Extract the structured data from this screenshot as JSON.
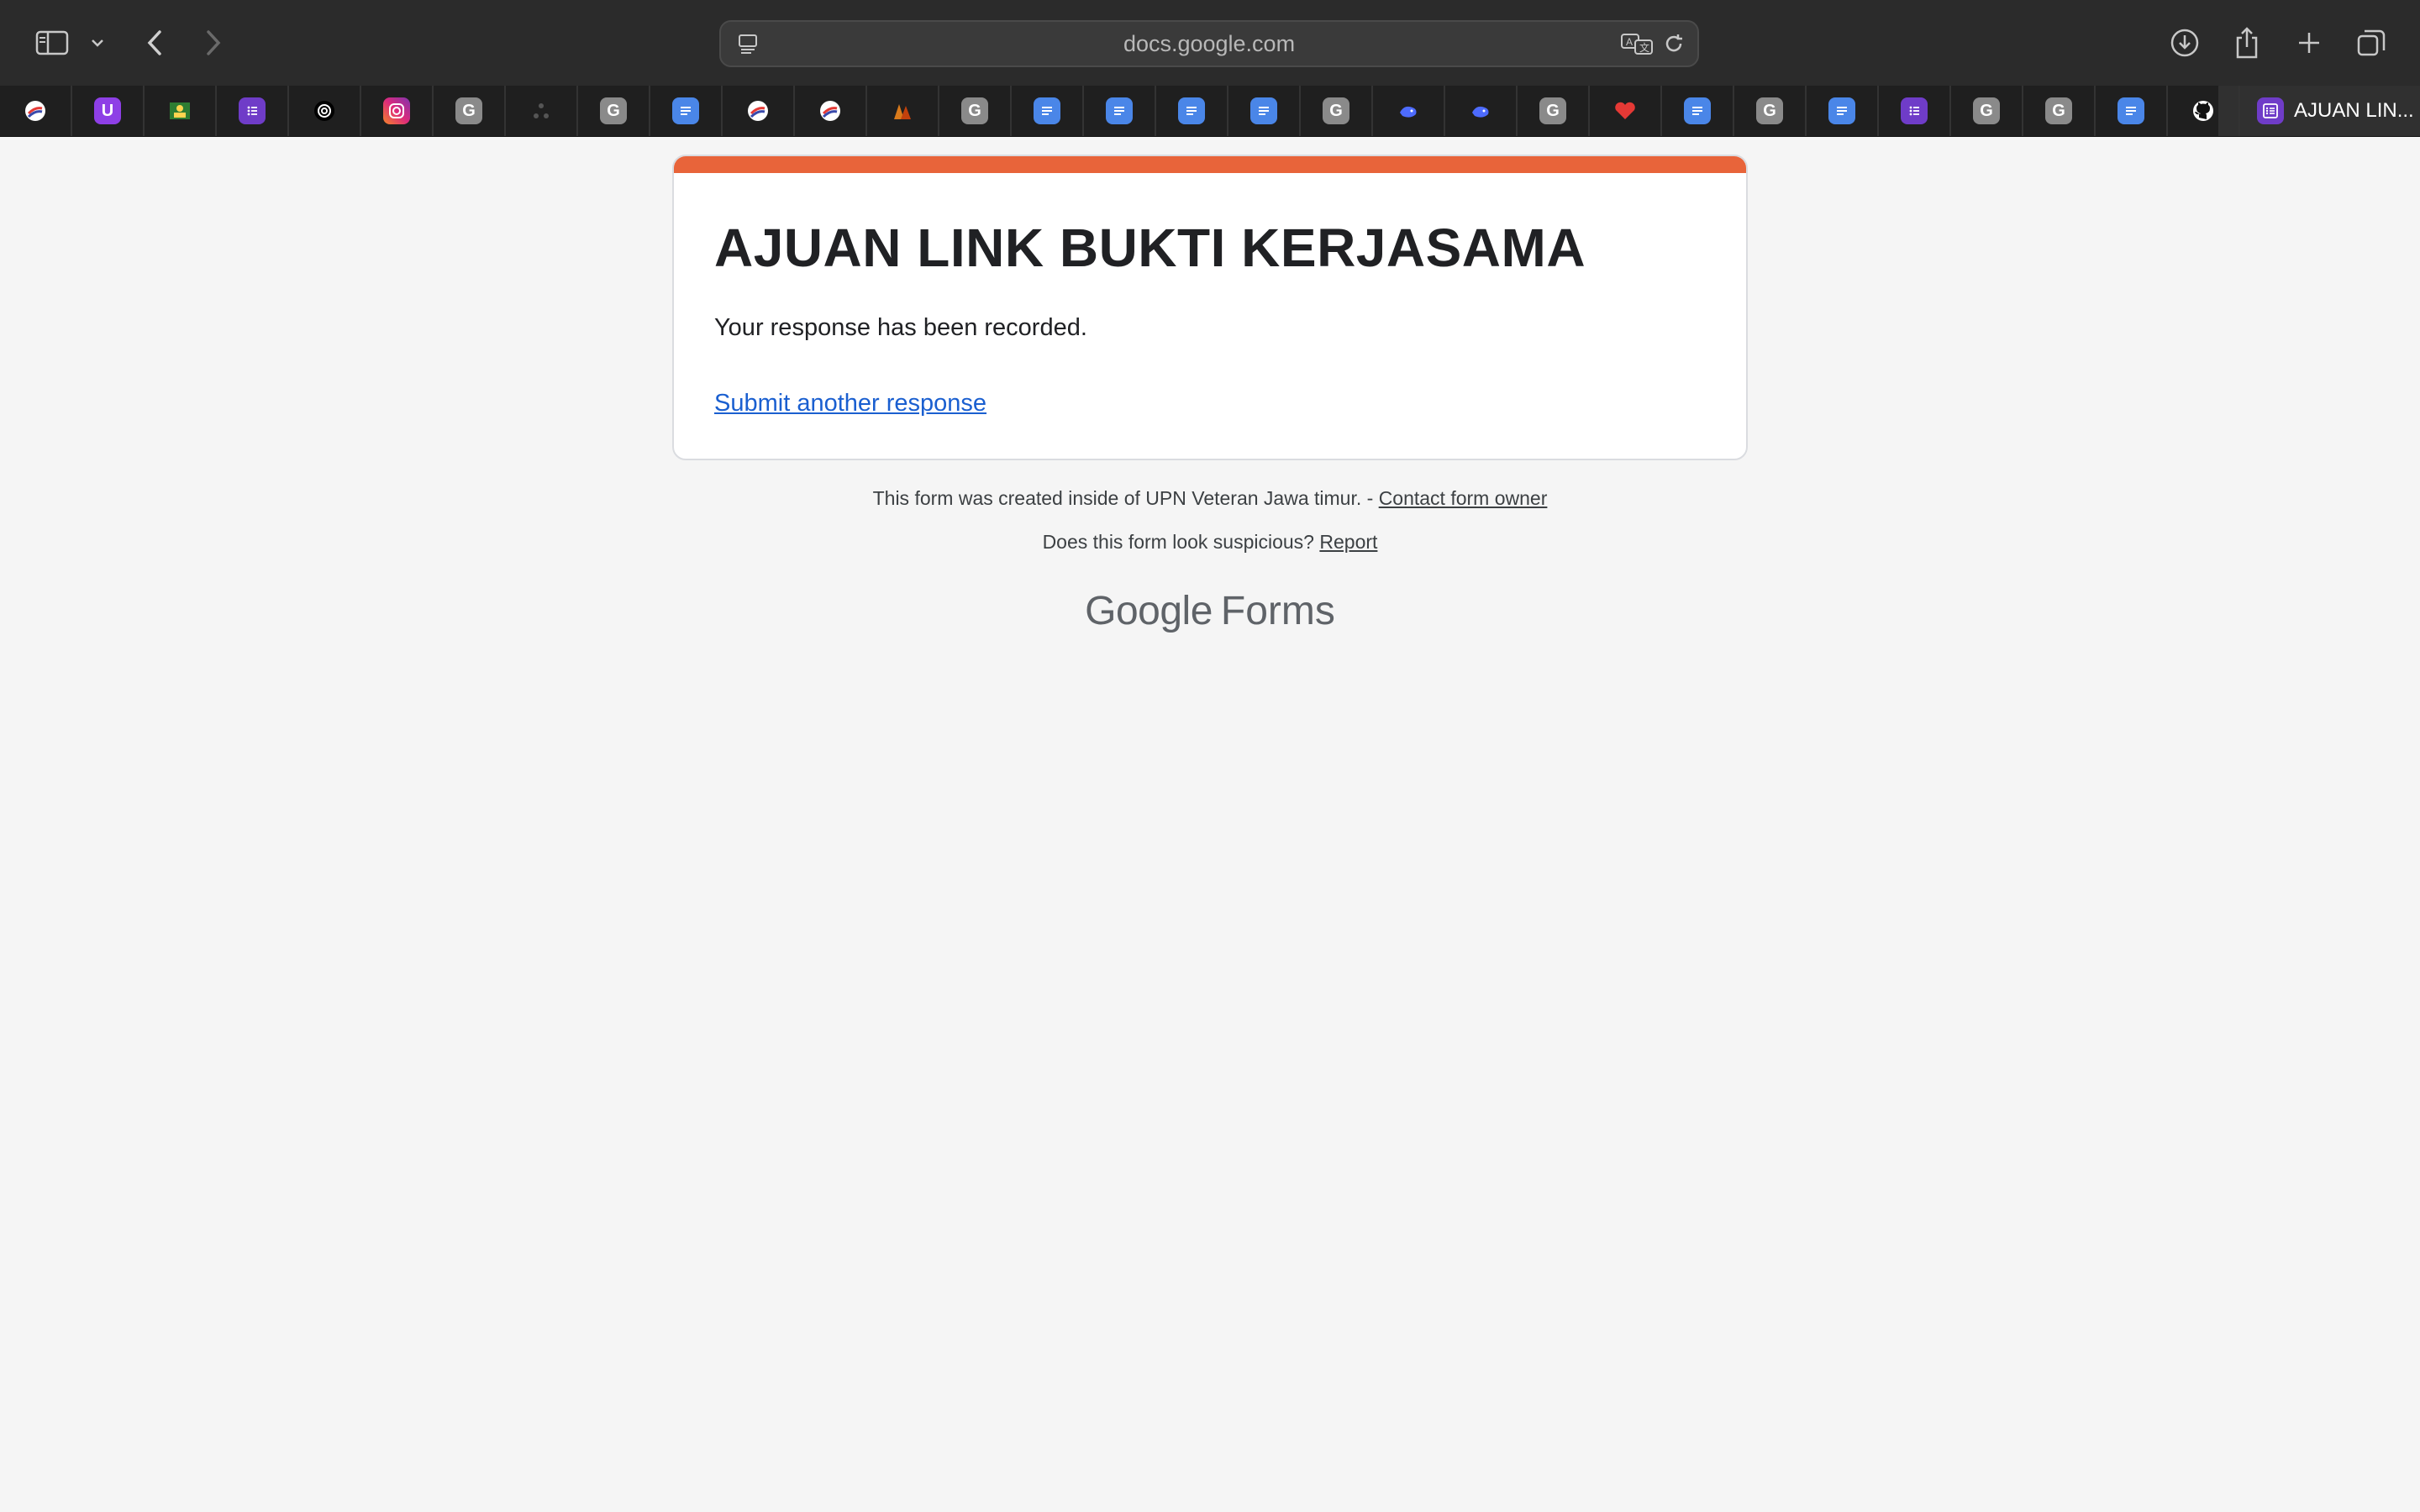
{
  "browser": {
    "url": "docs.google.com",
    "active_tab_title": "AJUAN LIN...",
    "tabs": [
      {
        "icon": "stripes-icon",
        "letter": "",
        "color": "#ffffff"
      },
      {
        "icon": "u-app-icon",
        "letter": "U",
        "color": "#8e3fe6"
      },
      {
        "icon": "photo-icon",
        "letter": "",
        "color": "#c8a23a"
      },
      {
        "icon": "forms-icon",
        "letter": "",
        "color": "#6f3cc8"
      },
      {
        "icon": "openai-icon",
        "letter": "",
        "color": "#000000"
      },
      {
        "icon": "instagram-icon",
        "letter": "",
        "color": "#e1306c"
      },
      {
        "icon": "generic-g-icon",
        "letter": "G",
        "color": "#8a8a8a"
      },
      {
        "icon": "network-icon",
        "letter": "",
        "color": "#bdbdbd"
      },
      {
        "icon": "generic-g-icon",
        "letter": "G",
        "color": "#8a8a8a"
      },
      {
        "icon": "docs-icon",
        "letter": "",
        "color": "#4a86e8"
      },
      {
        "icon": "stripes-icon",
        "letter": "",
        "color": "#ffffff"
      },
      {
        "icon": "stripes-icon",
        "letter": "",
        "color": "#ffffff"
      },
      {
        "icon": "pmm-icon",
        "letter": "",
        "color": "#d97a1b"
      },
      {
        "icon": "generic-g-icon",
        "letter": "G",
        "color": "#8a8a8a"
      },
      {
        "icon": "docs-icon",
        "letter": "",
        "color": "#4a86e8"
      },
      {
        "icon": "docs-icon",
        "letter": "",
        "color": "#4a86e8"
      },
      {
        "icon": "docs-icon",
        "letter": "",
        "color": "#4a86e8"
      },
      {
        "icon": "docs-icon",
        "letter": "",
        "color": "#4a86e8"
      },
      {
        "icon": "generic-g-icon",
        "letter": "G",
        "color": "#8a8a8a"
      },
      {
        "icon": "whale-icon",
        "letter": "",
        "color": "#e8eefc"
      },
      {
        "icon": "whale-icon",
        "letter": "",
        "color": "#e8eefc"
      },
      {
        "icon": "generic-g-icon",
        "letter": "G",
        "color": "#8a8a8a"
      },
      {
        "icon": "heart-icon",
        "letter": "",
        "color": "#e53935"
      },
      {
        "icon": "docs-icon",
        "letter": "",
        "color": "#4a86e8"
      },
      {
        "icon": "generic-g-icon",
        "letter": "G",
        "color": "#8a8a8a"
      },
      {
        "icon": "docs-icon",
        "letter": "",
        "color": "#4a86e8"
      },
      {
        "icon": "forms-icon",
        "letter": "",
        "color": "#6f3cc8"
      },
      {
        "icon": "generic-g-icon",
        "letter": "G",
        "color": "#8a8a8a"
      },
      {
        "icon": "generic-g-icon",
        "letter": "G",
        "color": "#8a8a8a"
      },
      {
        "icon": "docs-icon",
        "letter": "",
        "color": "#4a86e8"
      },
      {
        "icon": "github-icon",
        "letter": "",
        "color": "#ffffff"
      }
    ]
  },
  "form": {
    "accent_color": "#e8643a",
    "title": "AJUAN LINK BUKTI KERJASAMA",
    "confirmation": "Your response has been recorded.",
    "submit_another": "Submit another response"
  },
  "footer": {
    "created_text": "This form was created inside of UPN Veteran Jawa timur. -",
    "contact_link": "Contact form owner",
    "suspicious_text": "Does this form look suspicious?",
    "report_link": "Report",
    "brand_google": "Google",
    "brand_forms": "Forms"
  }
}
